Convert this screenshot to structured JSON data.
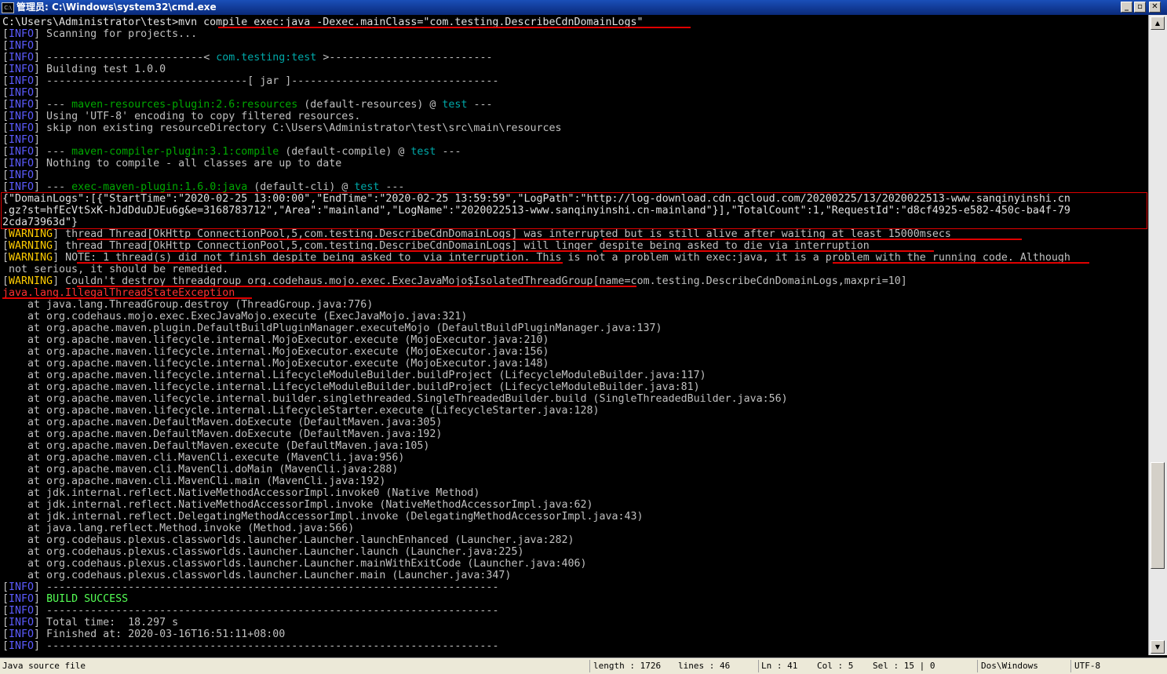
{
  "window": {
    "title": "管理员: C:\\Windows\\system32\\cmd.exe",
    "icon_label": "C:\\",
    "minimize": "_",
    "maximize": "▫",
    "close": "✕"
  },
  "console": {
    "lines": [
      [
        {
          "t": "C:\\Users\\Administrator\\test>mvn compile exec:java -Dexec.mainClass=\"com.testing.DescribeCdnDomainLogs\"",
          "c": "white"
        }
      ],
      [
        {
          "t": "[",
          "c": ""
        },
        {
          "t": "INFO",
          "c": "info"
        },
        {
          "t": "] Scanning for projects...",
          "c": ""
        }
      ],
      [
        {
          "t": "[",
          "c": ""
        },
        {
          "t": "INFO",
          "c": "info"
        },
        {
          "t": "]",
          "c": ""
        }
      ],
      [
        {
          "t": "[",
          "c": ""
        },
        {
          "t": "INFO",
          "c": "info"
        },
        {
          "t": "] -------------------------< ",
          "c": ""
        },
        {
          "t": "com.testing:test",
          "c": "cyan"
        },
        {
          "t": " >--------------------------",
          "c": ""
        }
      ],
      [
        {
          "t": "[",
          "c": ""
        },
        {
          "t": "INFO",
          "c": "info"
        },
        {
          "t": "] Building test 1.0.0",
          "c": ""
        }
      ],
      [
        {
          "t": "[",
          "c": ""
        },
        {
          "t": "INFO",
          "c": "info"
        },
        {
          "t": "] --------------------------------[ jar ]---------------------------------",
          "c": ""
        }
      ],
      [
        {
          "t": "[",
          "c": ""
        },
        {
          "t": "INFO",
          "c": "info"
        },
        {
          "t": "]",
          "c": ""
        }
      ],
      [
        {
          "t": "[",
          "c": ""
        },
        {
          "t": "INFO",
          "c": "info"
        },
        {
          "t": "] --- ",
          "c": ""
        },
        {
          "t": "maven-resources-plugin:2.6:resources",
          "c": "green"
        },
        {
          "t": " (default-resources) @ ",
          "c": ""
        },
        {
          "t": "test",
          "c": "cyan"
        },
        {
          "t": " ---",
          "c": ""
        }
      ],
      [
        {
          "t": "[",
          "c": ""
        },
        {
          "t": "INFO",
          "c": "info"
        },
        {
          "t": "] Using 'UTF-8' encoding to copy filtered resources.",
          "c": ""
        }
      ],
      [
        {
          "t": "[",
          "c": ""
        },
        {
          "t": "INFO",
          "c": "info"
        },
        {
          "t": "] skip non existing resourceDirectory C:\\Users\\Administrator\\test\\src\\main\\resources",
          "c": ""
        }
      ],
      [
        {
          "t": "[",
          "c": ""
        },
        {
          "t": "INFO",
          "c": "info"
        },
        {
          "t": "]",
          "c": ""
        }
      ],
      [
        {
          "t": "[",
          "c": ""
        },
        {
          "t": "INFO",
          "c": "info"
        },
        {
          "t": "] --- ",
          "c": ""
        },
        {
          "t": "maven-compiler-plugin:3.1:compile",
          "c": "green"
        },
        {
          "t": " (default-compile) @ ",
          "c": ""
        },
        {
          "t": "test",
          "c": "cyan"
        },
        {
          "t": " ---",
          "c": ""
        }
      ],
      [
        {
          "t": "[",
          "c": ""
        },
        {
          "t": "INFO",
          "c": "info"
        },
        {
          "t": "] Nothing to compile - all classes are up to date",
          "c": ""
        }
      ],
      [
        {
          "t": "[",
          "c": ""
        },
        {
          "t": "INFO",
          "c": "info"
        },
        {
          "t": "]",
          "c": ""
        }
      ],
      [
        {
          "t": "[",
          "c": ""
        },
        {
          "t": "INFO",
          "c": "info"
        },
        {
          "t": "] --- ",
          "c": ""
        },
        {
          "t": "exec-maven-plugin:1.6.0:java",
          "c": "green"
        },
        {
          "t": " (default-cli) @ ",
          "c": ""
        },
        {
          "t": "test",
          "c": "cyan"
        },
        {
          "t": " ---",
          "c": ""
        }
      ],
      [
        {
          "t": "{\"DomainLogs\":[{\"StartTime\":\"2020-02-25 13:00:00\",\"EndTime\":\"2020-02-25 13:59:59\",\"LogPath\":\"http://log-download.cdn.qcloud.com/20200225/13/2020022513-www.sanqinyinshi.cn",
          "c": "white"
        }
      ],
      [
        {
          "t": ".gz?st=hfEcVtSxK-hJdDduDJEu6g&e=3168783712\",\"Area\":\"mainland\",\"LogName\":\"2020022513-www.sanqinyinshi.cn-mainland\"}],\"TotalCount\":1,\"RequestId\":\"d8cf4925-e582-450c-ba4f-79",
          "c": "white"
        }
      ],
      [
        {
          "t": "2cda73963d\"}",
          "c": "white"
        }
      ],
      [
        {
          "t": "[",
          "c": ""
        },
        {
          "t": "WARNING",
          "c": "warn"
        },
        {
          "t": "] thread Thread[OkHttp ConnectionPool,5,com.testing.DescribeCdnDomainLogs] was interrupted but is still alive after waiting at least 15000msecs",
          "c": ""
        }
      ],
      [
        {
          "t": "[",
          "c": ""
        },
        {
          "t": "WARNING",
          "c": "warn"
        },
        {
          "t": "] thread Thread[OkHttp ConnectionPool,5,com.testing.DescribeCdnDomainLogs] will linger despite being asked to die via interruption",
          "c": ""
        }
      ],
      [
        {
          "t": "[",
          "c": ""
        },
        {
          "t": "WARNING",
          "c": "warn"
        },
        {
          "t": "] NOTE: 1 thread(s) did not finish despite being asked to  via interruption. This is not a problem with exec:java, it is a problem with the running code. Although",
          "c": ""
        }
      ],
      [
        {
          "t": " not serious, it should be remedied.",
          "c": ""
        }
      ],
      [
        {
          "t": "[",
          "c": ""
        },
        {
          "t": "WARNING",
          "c": "warn"
        },
        {
          "t": "] Couldn't destroy threadgroup org.codehaus.mojo.exec.ExecJavaMojo$IsolatedThreadGroup[name=com.testing.DescribeCdnDomainLogs,maxpri=10]",
          "c": ""
        }
      ],
      [
        {
          "t": "java.lang.IllegalThreadStateException",
          "c": "err"
        }
      ],
      [
        {
          "t": "    at java.lang.ThreadGroup.destroy (ThreadGroup.java:776)",
          "c": ""
        }
      ],
      [
        {
          "t": "    at org.codehaus.mojo.exec.ExecJavaMojo.execute (ExecJavaMojo.java:321)",
          "c": ""
        }
      ],
      [
        {
          "t": "    at org.apache.maven.plugin.DefaultBuildPluginManager.executeMojo (DefaultBuildPluginManager.java:137)",
          "c": ""
        }
      ],
      [
        {
          "t": "    at org.apache.maven.lifecycle.internal.MojoExecutor.execute (MojoExecutor.java:210)",
          "c": ""
        }
      ],
      [
        {
          "t": "    at org.apache.maven.lifecycle.internal.MojoExecutor.execute (MojoExecutor.java:156)",
          "c": ""
        }
      ],
      [
        {
          "t": "    at org.apache.maven.lifecycle.internal.MojoExecutor.execute (MojoExecutor.java:148)",
          "c": ""
        }
      ],
      [
        {
          "t": "    at org.apache.maven.lifecycle.internal.LifecycleModuleBuilder.buildProject (LifecycleModuleBuilder.java:117)",
          "c": ""
        }
      ],
      [
        {
          "t": "    at org.apache.maven.lifecycle.internal.LifecycleModuleBuilder.buildProject (LifecycleModuleBuilder.java:81)",
          "c": ""
        }
      ],
      [
        {
          "t": "    at org.apache.maven.lifecycle.internal.builder.singlethreaded.SingleThreadedBuilder.build (SingleThreadedBuilder.java:56)",
          "c": ""
        }
      ],
      [
        {
          "t": "    at org.apache.maven.lifecycle.internal.LifecycleStarter.execute (LifecycleStarter.java:128)",
          "c": ""
        }
      ],
      [
        {
          "t": "    at org.apache.maven.DefaultMaven.doExecute (DefaultMaven.java:305)",
          "c": ""
        }
      ],
      [
        {
          "t": "    at org.apache.maven.DefaultMaven.doExecute (DefaultMaven.java:192)",
          "c": ""
        }
      ],
      [
        {
          "t": "    at org.apache.maven.DefaultMaven.execute (DefaultMaven.java:105)",
          "c": ""
        }
      ],
      [
        {
          "t": "    at org.apache.maven.cli.MavenCli.execute (MavenCli.java:956)",
          "c": ""
        }
      ],
      [
        {
          "t": "    at org.apache.maven.cli.MavenCli.doMain (MavenCli.java:288)",
          "c": ""
        }
      ],
      [
        {
          "t": "    at org.apache.maven.cli.MavenCli.main (MavenCli.java:192)",
          "c": ""
        }
      ],
      [
        {
          "t": "    at jdk.internal.reflect.NativeMethodAccessorImpl.invoke0 (Native Method)",
          "c": ""
        }
      ],
      [
        {
          "t": "    at jdk.internal.reflect.NativeMethodAccessorImpl.invoke (NativeMethodAccessorImpl.java:62)",
          "c": ""
        }
      ],
      [
        {
          "t": "    at jdk.internal.reflect.DelegatingMethodAccessorImpl.invoke (DelegatingMethodAccessorImpl.java:43)",
          "c": ""
        }
      ],
      [
        {
          "t": "    at java.lang.reflect.Method.invoke (Method.java:566)",
          "c": ""
        }
      ],
      [
        {
          "t": "    at org.codehaus.plexus.classworlds.launcher.Launcher.launchEnhanced (Launcher.java:282)",
          "c": ""
        }
      ],
      [
        {
          "t": "    at org.codehaus.plexus.classworlds.launcher.Launcher.launch (Launcher.java:225)",
          "c": ""
        }
      ],
      [
        {
          "t": "    at org.codehaus.plexus.classworlds.launcher.Launcher.mainWithExitCode (Launcher.java:406)",
          "c": ""
        }
      ],
      [
        {
          "t": "    at org.codehaus.plexus.classworlds.launcher.Launcher.main (Launcher.java:347)",
          "c": ""
        }
      ],
      [
        {
          "t": "[",
          "c": ""
        },
        {
          "t": "INFO",
          "c": "info"
        },
        {
          "t": "] ------------------------------------------------------------------------",
          "c": ""
        }
      ],
      [
        {
          "t": "[",
          "c": ""
        },
        {
          "t": "INFO",
          "c": "info"
        },
        {
          "t": "] ",
          "c": ""
        },
        {
          "t": "BUILD SUCCESS",
          "c": "bright"
        }
      ],
      [
        {
          "t": "[",
          "c": ""
        },
        {
          "t": "INFO",
          "c": "info"
        },
        {
          "t": "] ------------------------------------------------------------------------",
          "c": ""
        }
      ],
      [
        {
          "t": "[",
          "c": ""
        },
        {
          "t": "INFO",
          "c": "info"
        },
        {
          "t": "] Total time:  18.297 s",
          "c": ""
        }
      ],
      [
        {
          "t": "[",
          "c": ""
        },
        {
          "t": "INFO",
          "c": "info"
        },
        {
          "t": "] Finished at: 2020-03-16T16:51:11+08:00",
          "c": ""
        }
      ],
      [
        {
          "t": "[",
          "c": ""
        },
        {
          "t": "INFO",
          "c": "info"
        },
        {
          "t": "] ------------------------------------------------------------------------",
          "c": ""
        }
      ]
    ]
  },
  "scrollbar": {
    "up": "▲",
    "down": "▼"
  },
  "status": {
    "file_type": "Java source file",
    "length": "length : 1726",
    "lines": "lines : 46",
    "ln": "Ln : 41",
    "col": "Col : 5",
    "sel": "Sel : 15 | 0",
    "eol": "Dos\\Windows",
    "encoding": "UTF-8"
  },
  "colors": {
    "background": "#000000",
    "text": "#c0c0c0",
    "info": "#5b5bff",
    "warning": "#ffcc00",
    "error": "#ff3030",
    "annotation": "#e00000",
    "titlebar": "#1a4fb8"
  }
}
